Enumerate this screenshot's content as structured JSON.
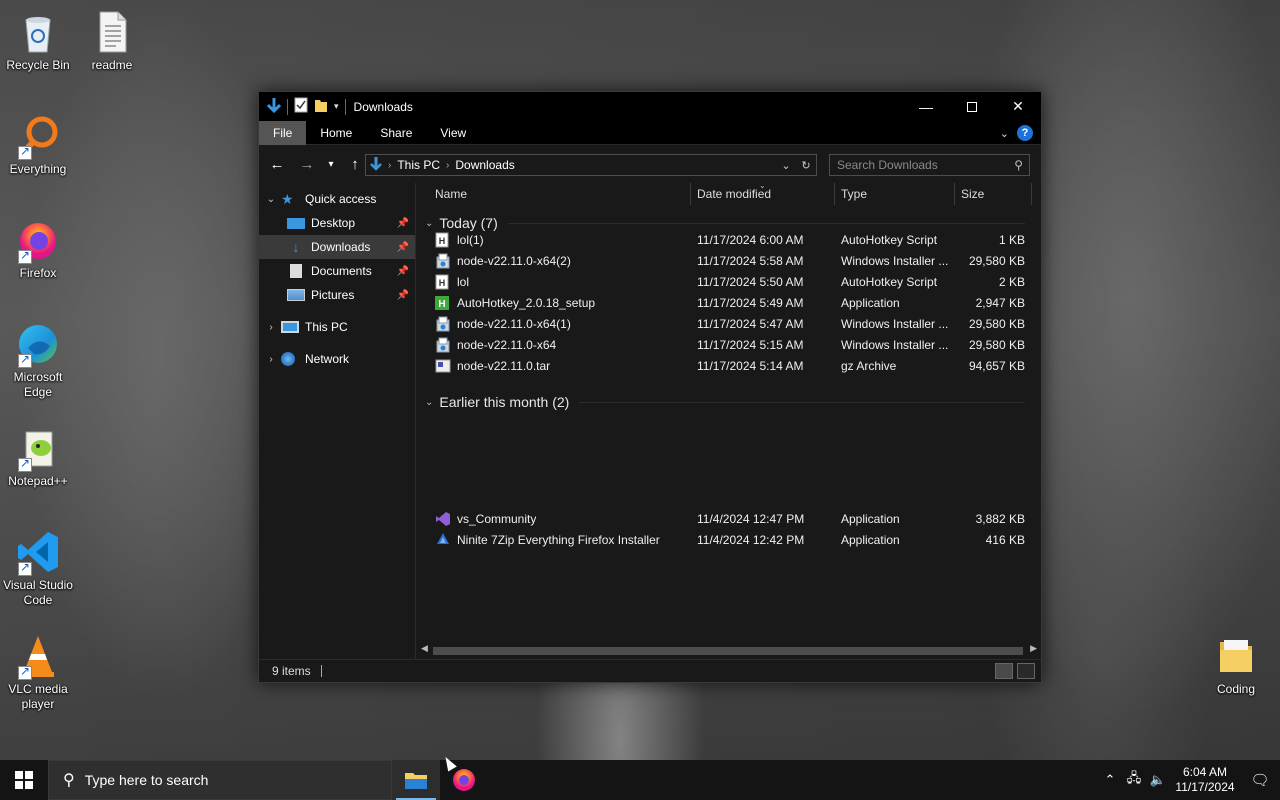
{
  "desktop": {
    "icons": [
      {
        "label": "Recycle Bin",
        "icon": "recycle-bin-icon"
      },
      {
        "label": "readme",
        "icon": "text-file-icon"
      },
      {
        "label": "Everything",
        "icon": "everything-search-icon"
      },
      {
        "label": "Firefox",
        "icon": "firefox-icon"
      },
      {
        "label": "Microsoft Edge",
        "icon": "edge-icon"
      },
      {
        "label": "Notepad++",
        "icon": "notepad-plus-plus-icon"
      },
      {
        "label": "Visual Studio Code",
        "icon": "vscode-icon"
      },
      {
        "label": "VLC media player",
        "icon": "vlc-icon"
      },
      {
        "label": "Coding",
        "icon": "folder-icon"
      }
    ]
  },
  "explorer": {
    "title": "Downloads",
    "ribbon_tabs": [
      "File",
      "Home",
      "Share",
      "View"
    ],
    "help_label": "?",
    "address": {
      "crumbs": [
        "This PC",
        "Downloads"
      ]
    },
    "search_placeholder": "Search Downloads",
    "nav": {
      "quick_access": "Quick access",
      "items": [
        {
          "label": "Desktop",
          "pinned": true
        },
        {
          "label": "Downloads",
          "pinned": true,
          "selected": true
        },
        {
          "label": "Documents",
          "pinned": true
        },
        {
          "label": "Pictures",
          "pinned": true
        }
      ],
      "this_pc": "This PC",
      "network": "Network"
    },
    "columns": {
      "name": "Name",
      "date": "Date modified",
      "type": "Type",
      "size": "Size"
    },
    "groups": [
      {
        "title": "Today (7)",
        "files": [
          {
            "name": "lol(1)",
            "date": "11/17/2024 6:00 AM",
            "type": "AutoHotkey Script",
            "size": "1 KB",
            "icon": "ahk-script-icon"
          },
          {
            "name": "node-v22.11.0-x64(2)",
            "date": "11/17/2024 5:58 AM",
            "type": "Windows Installer ...",
            "size": "29,580 KB",
            "icon": "msi-installer-icon"
          },
          {
            "name": "lol",
            "date": "11/17/2024 5:50 AM",
            "type": "AutoHotkey Script",
            "size": "2 KB",
            "icon": "ahk-script-icon"
          },
          {
            "name": "AutoHotkey_2.0.18_setup",
            "date": "11/17/2024 5:49 AM",
            "type": "Application",
            "size": "2,947 KB",
            "icon": "autohotkey-app-icon"
          },
          {
            "name": "node-v22.11.0-x64(1)",
            "date": "11/17/2024 5:47 AM",
            "type": "Windows Installer ...",
            "size": "29,580 KB",
            "icon": "msi-installer-icon"
          },
          {
            "name": "node-v22.11.0-x64",
            "date": "11/17/2024 5:15 AM",
            "type": "Windows Installer ...",
            "size": "29,580 KB",
            "icon": "msi-installer-icon"
          },
          {
            "name": "node-v22.11.0.tar",
            "date": "11/17/2024 5:14 AM",
            "type": "gz Archive",
            "size": "94,657 KB",
            "icon": "archive-icon"
          }
        ]
      },
      {
        "title": "Earlier this month (2)",
        "files": [
          {
            "name": "vs_Community",
            "date": "11/4/2024 12:47 PM",
            "type": "Application",
            "size": "3,882 KB",
            "icon": "visual-studio-icon"
          },
          {
            "name": "Ninite 7Zip Everything Firefox Installer",
            "date": "11/4/2024 12:42 PM",
            "type": "Application",
            "size": "416 KB",
            "icon": "ninite-icon"
          }
        ]
      }
    ],
    "status": {
      "item_count": "9 items"
    }
  },
  "taskbar": {
    "search_placeholder": "Type here to search",
    "time": "6:04 AM",
    "date": "11/17/2024"
  }
}
